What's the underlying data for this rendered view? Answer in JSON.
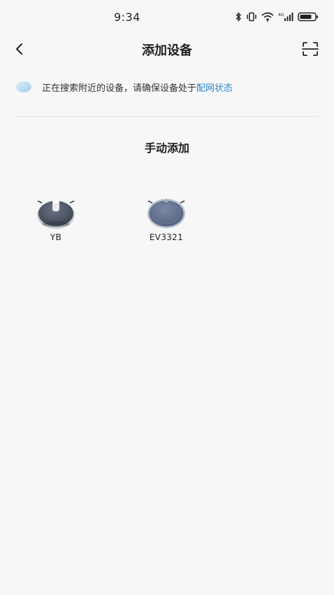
{
  "status_bar": {
    "time": "9:34",
    "icons": [
      "bluetooth-icon",
      "vibrate-icon",
      "wifi-icon",
      "cellular-signal-icon",
      "battery-icon"
    ]
  },
  "nav": {
    "title": "添加设备",
    "back_icon": "chevron-left-icon",
    "scan_icon": "scan-icon"
  },
  "search_notice": {
    "text": "正在搜索附近的设备，请确保设备处于",
    "link_text": "配网状态",
    "link_color": "#2a86c8",
    "icon": "searching-icon"
  },
  "manual_add": {
    "title": "手动添加",
    "devices": [
      {
        "label": "YB",
        "icon": "robot-vacuum-icon"
      },
      {
        "label": "EV3321",
        "icon": "robot-vacuum-icon"
      }
    ]
  }
}
